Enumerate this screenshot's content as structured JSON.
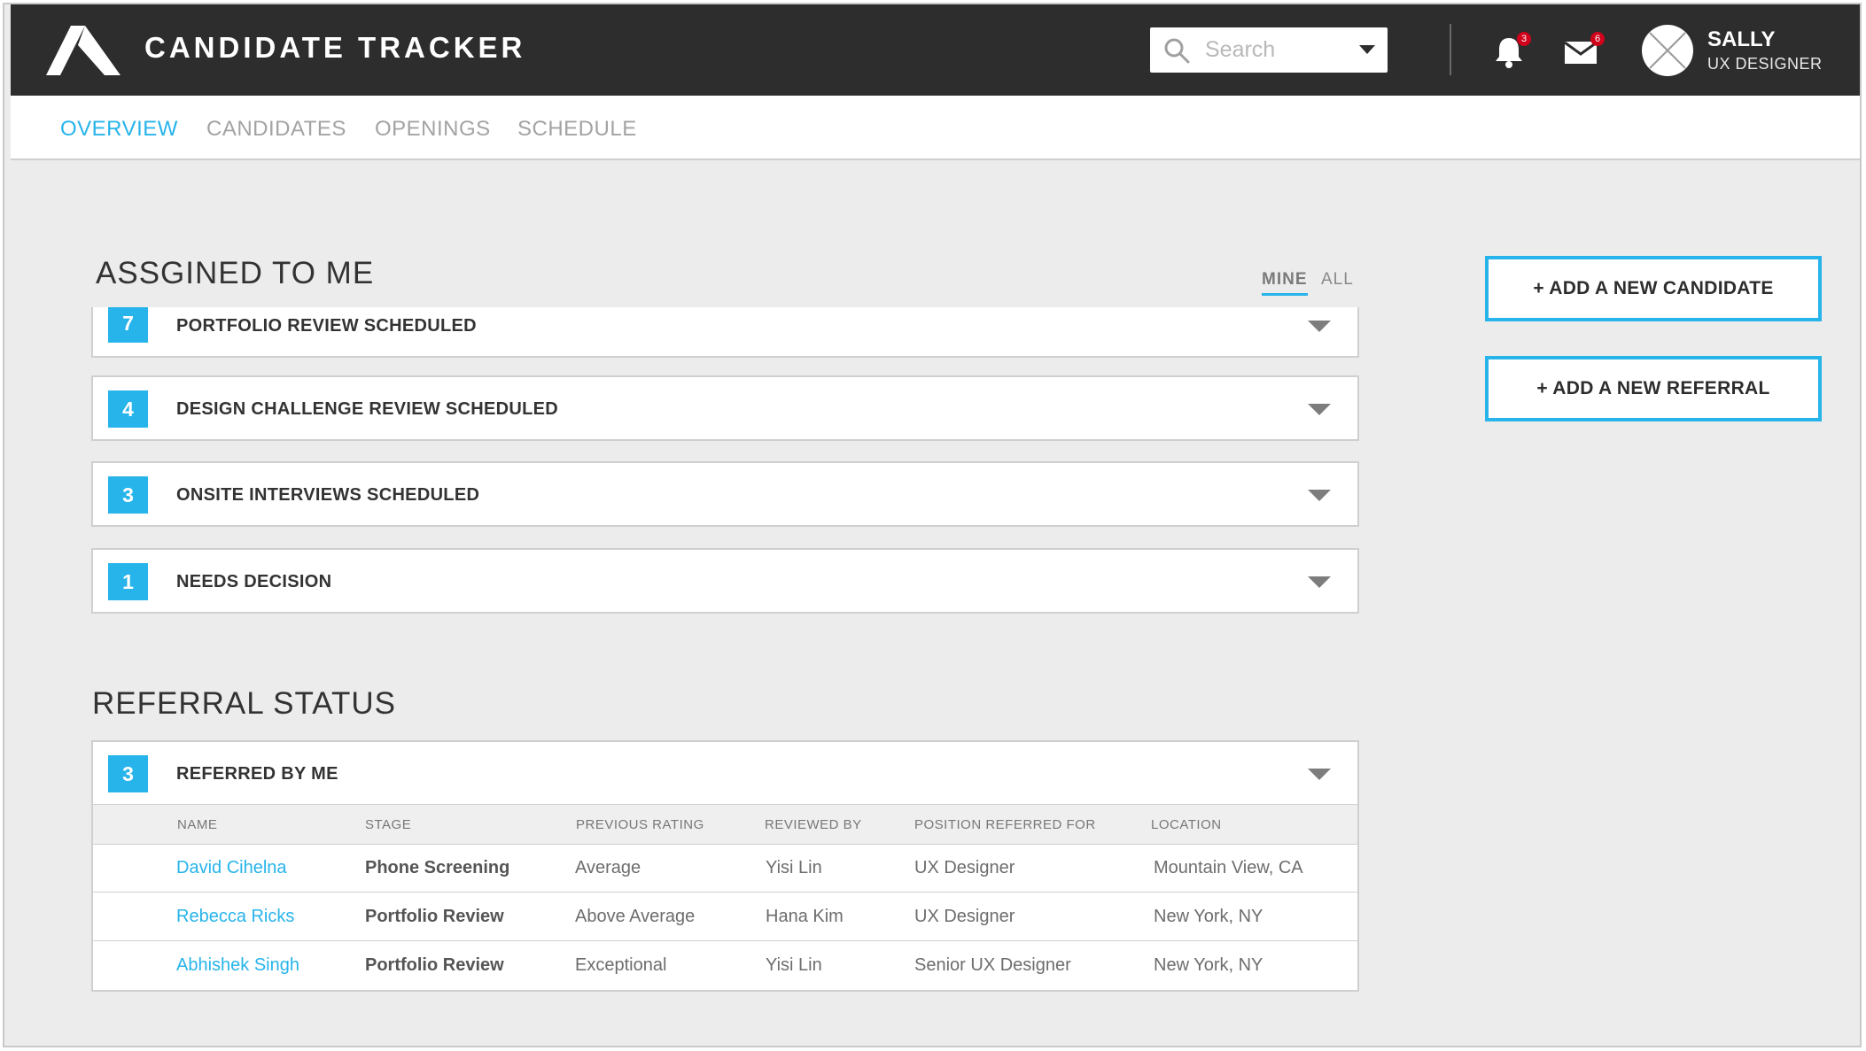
{
  "app": {
    "title": "CANDIDATE TRACKER"
  },
  "search": {
    "placeholder": "Search"
  },
  "notifications": {
    "bell_count": "3",
    "mail_count": "6"
  },
  "user": {
    "name": "SALLY",
    "role": "UX DESIGNER"
  },
  "nav": {
    "tabs": [
      {
        "label": "OVERVIEW",
        "active": true
      },
      {
        "label": "CANDIDATES",
        "active": false
      },
      {
        "label": "OPENINGS",
        "active": false
      },
      {
        "label": "SCHEDULE",
        "active": false
      }
    ]
  },
  "assigned": {
    "heading": "ASSGINED TO ME",
    "filter_mine": "MINE",
    "filter_all": "ALL",
    "groups": [
      {
        "count": "7",
        "label": "PORTFOLIO REVIEW SCHEDULED"
      },
      {
        "count": "4",
        "label": "DESIGN CHALLENGE REVIEW SCHEDULED"
      },
      {
        "count": "3",
        "label": "ONSITE INTERVIEWS SCHEDULED"
      },
      {
        "count": "1",
        "label": "NEEDS DECISION"
      }
    ]
  },
  "actions": {
    "add_candidate": "+ ADD A NEW CANDIDATE",
    "add_referral": "+ ADD A NEW REFERRAL"
  },
  "referral": {
    "heading": "REFERRAL STATUS",
    "group": {
      "count": "3",
      "label": "REFERRED BY ME"
    },
    "columns": [
      "NAME",
      "STAGE",
      "PREVIOUS RATING",
      "REVIEWED BY",
      "POSITION REFERRED FOR",
      "LOCATION"
    ],
    "rows": [
      {
        "name": "David Cihelna",
        "stage": "Phone Screening",
        "rating": "Average",
        "reviewer": "Yisi Lin",
        "position": "UX Designer",
        "location": "Mountain View, CA"
      },
      {
        "name": "Rebecca Ricks",
        "stage": "Portfolio Review",
        "rating": "Above Average",
        "reviewer": "Hana Kim",
        "position": "UX Designer",
        "location": "New York, NY"
      },
      {
        "name": "Abhishek Singh",
        "stage": "Portfolio Review",
        "rating": "Exceptional",
        "reviewer": "Yisi Lin",
        "position": "Senior UX Designer",
        "location": "New York, NY"
      }
    ]
  },
  "colors": {
    "accent": "#27b4ea",
    "topbar": "#2d2d2d",
    "background": "#ececec",
    "badge": "#d0021b"
  }
}
